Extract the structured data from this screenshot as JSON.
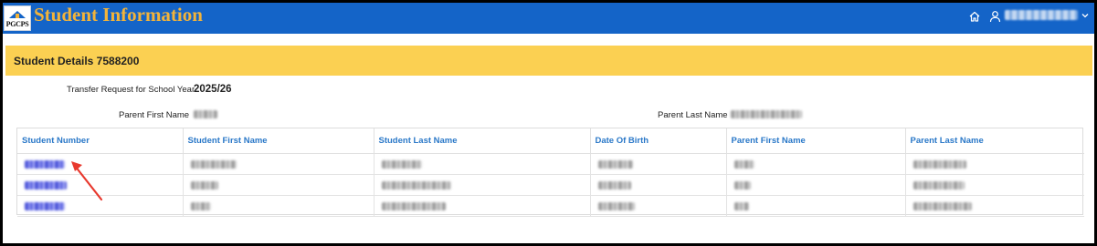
{
  "header": {
    "logo_text": "PGCPS",
    "title": "Student Information",
    "home_icon": "home-icon",
    "user_icon": "user-icon",
    "user_name": "",
    "menu_icon": "chevron-down-icon",
    "bar_color": "#1464c8",
    "title_color": "#f2b33a"
  },
  "section": {
    "title": "Student Details 7588200",
    "bar_color": "#fbd052"
  },
  "details": {
    "transfer_label": "Transfer Request for School Year",
    "transfer_value": "2025/26",
    "parent_first_label": "Parent First Name",
    "parent_first_value": "",
    "parent_last_label": "Parent Last Name",
    "parent_last_value": ""
  },
  "table": {
    "columns": [
      "Student Number",
      "Student First Name",
      "Student Last Name",
      "Date Of Birth",
      "Parent First Name",
      "Parent Last Name"
    ],
    "rows": [
      [
        "",
        "",
        "",
        "",
        "",
        ""
      ],
      [
        "",
        "",
        "",
        "",
        "",
        ""
      ],
      [
        "",
        "",
        "",
        "",
        "",
        ""
      ]
    ],
    "header_color": "#2a78c8",
    "link_color": "#3a43d6"
  },
  "annotation": {
    "arrow_color": "#e8392e"
  }
}
